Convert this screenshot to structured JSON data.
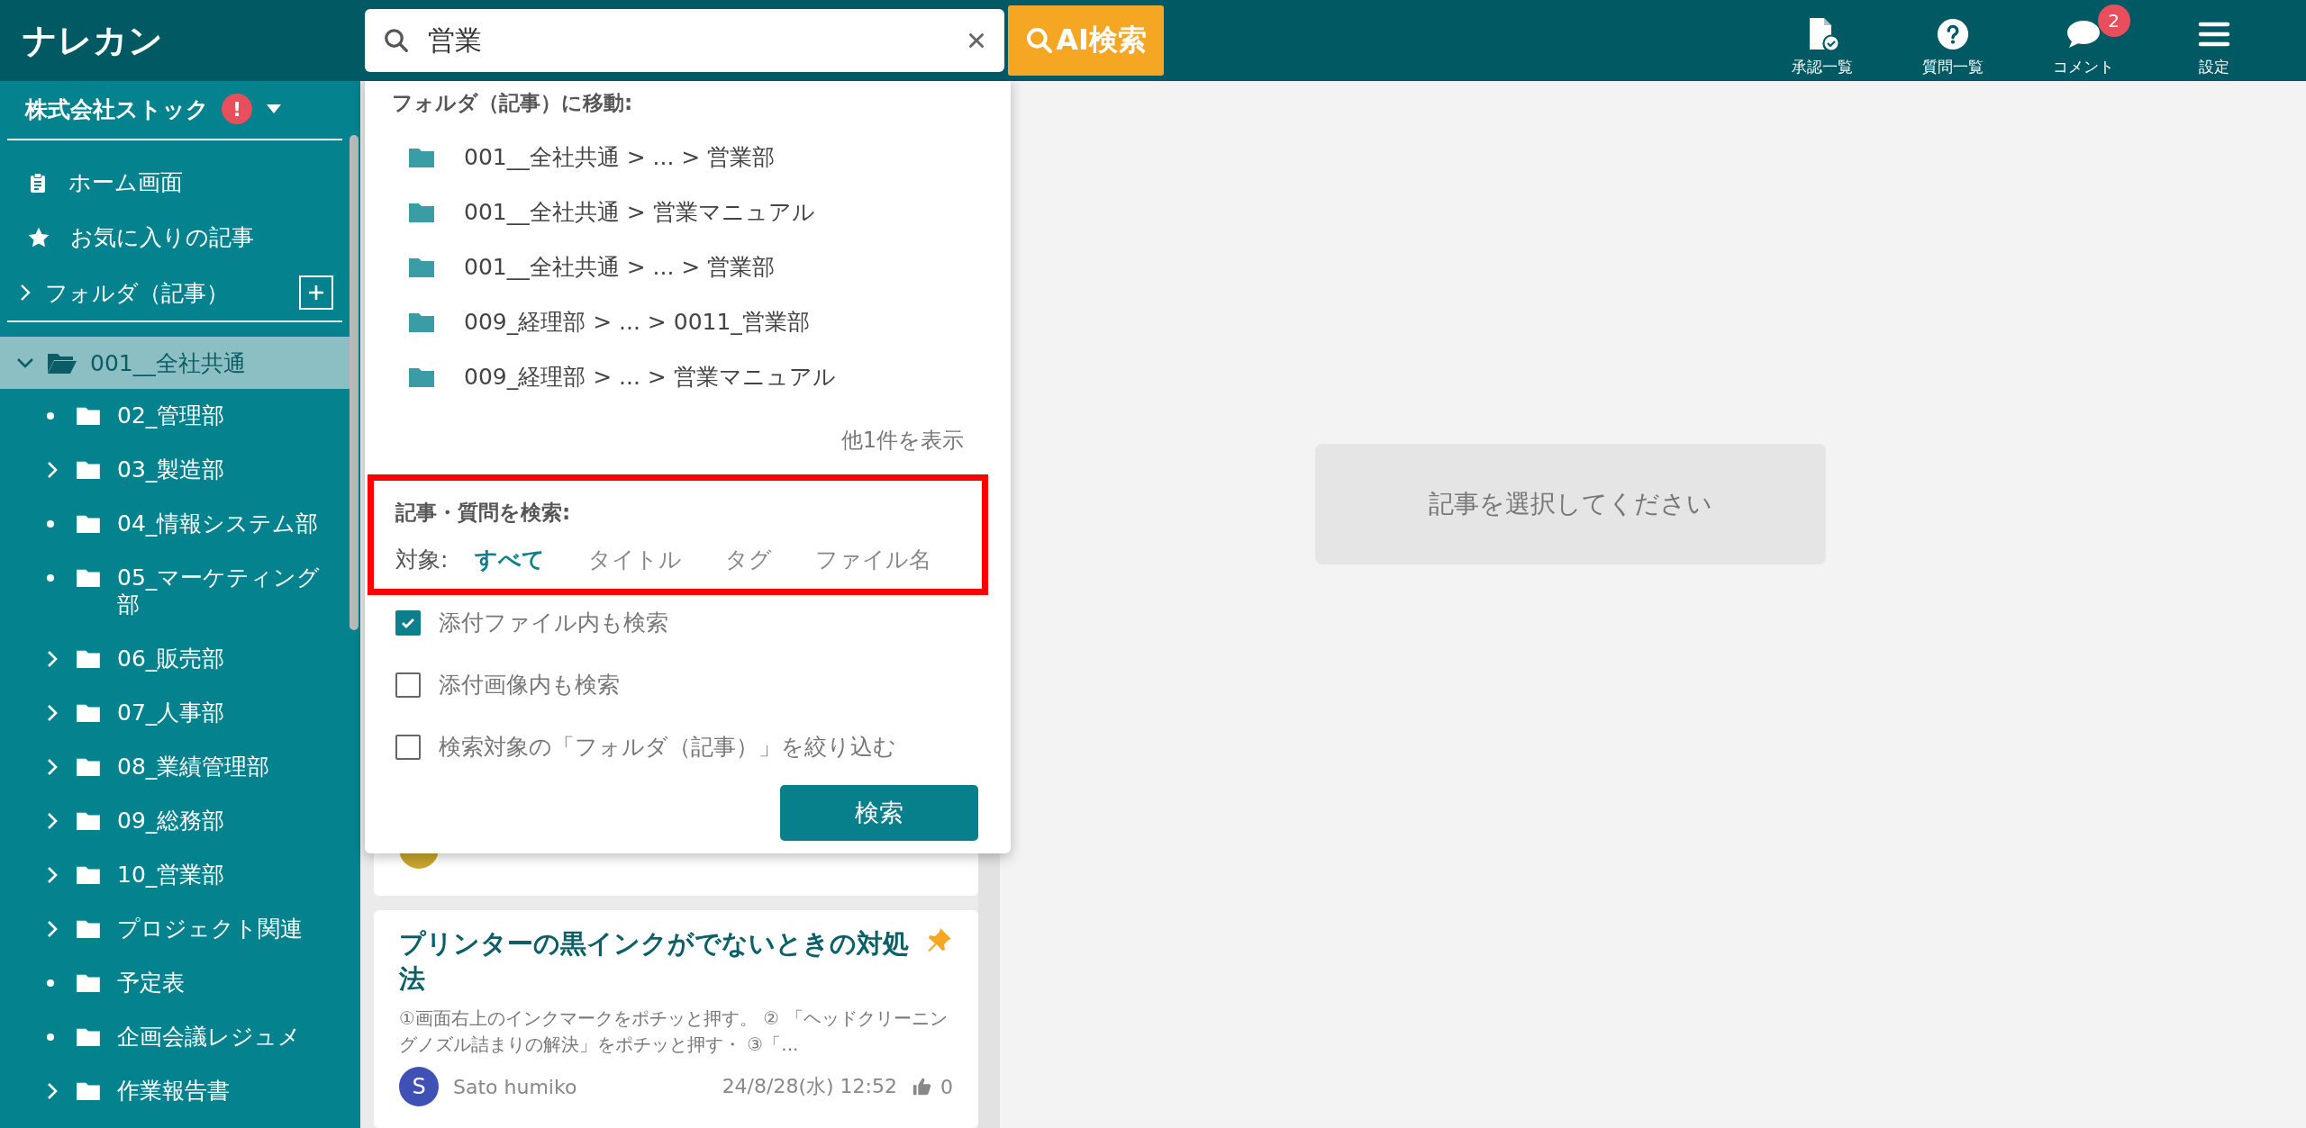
{
  "app": {
    "logo": "ナレカン"
  },
  "search": {
    "value": "営業",
    "ai_button": "AI検索"
  },
  "header_actions": [
    {
      "kind": "approval",
      "label": "承認一覧"
    },
    {
      "kind": "question",
      "label": "質問一覧"
    },
    {
      "kind": "comment",
      "label": "コメント",
      "badge": "2"
    },
    {
      "kind": "menu",
      "label": "設定"
    }
  ],
  "sidebar": {
    "company": "株式会社ストック",
    "alert": "!",
    "nav": [
      {
        "kind": "home",
        "label": "ホーム画面"
      },
      {
        "kind": "favorite",
        "label": "お気に入りの記事"
      }
    ],
    "folders": {
      "label": "フォルダ（記事）",
      "expanded": false
    },
    "tree": [
      {
        "label": "001__全社共通",
        "expanded": true,
        "selected": true,
        "children": [
          {
            "label": "02_管理部",
            "expandable": false,
            "selected": false
          },
          {
            "label": "03_製造部",
            "expandable": true,
            "selected": false
          },
          {
            "label": "04_情報システム部",
            "expandable": false,
            "selected": false
          },
          {
            "label": "05_マーケティング部",
            "expandable": false,
            "selected": false
          },
          {
            "label": "06_販売部",
            "expandable": true,
            "selected": false
          },
          {
            "label": "07_人事部",
            "expandable": true,
            "selected": false
          },
          {
            "label": "08_業績管理部",
            "expandable": true,
            "selected": false
          },
          {
            "label": "09_総務部",
            "expandable": true,
            "selected": false
          },
          {
            "label": "10_営業部",
            "expandable": true,
            "selected": false
          },
          {
            "label": "プロジェクト関連",
            "expandable": true,
            "selected": false
          },
          {
            "label": "予定表",
            "expandable": false,
            "selected": false
          },
          {
            "label": "企画会議レジュメ",
            "expandable": false,
            "selected": false
          },
          {
            "label": "作業報告書",
            "expandable": true,
            "selected": false
          }
        ]
      }
    ]
  },
  "articles": [
    {
      "color": "#c9a52c",
      "pinned": false
    },
    {
      "title": "プリンターの黒インクがでないときの対処法",
      "excerpt": "①画面右上のインクマークをポチッと押す。 ② 「ヘッドクリーニングノズル詰まりの解決」をポチッと押す・ ③「...",
      "avatar_letter": "S",
      "color": "#3f51b5",
      "author": "Sato humiko",
      "date": "24/8/28(水) 12:52",
      "likes": "0",
      "pinned": true
    }
  ],
  "dropdown": {
    "folder_heading": "フォルダ（記事）に移動:",
    "folder_results": [
      "001__全社共通 > ... > 営業部",
      "001__全社共通 > 営業マニュアル",
      "001__全社共通 > ... > 営業部",
      "009_経理部 > ... > 0011_営業部",
      "009_経理部 > ... > 営業マニュアル"
    ],
    "more_link": "他1件を表示",
    "highlighted": true,
    "search_heading": "記事・質問を検索:",
    "target_label": "対象:",
    "targets": [
      {
        "label": "すべて",
        "selected": true
      },
      {
        "label": "タイトル",
        "selected": false
      },
      {
        "label": "タグ",
        "selected": false
      },
      {
        "label": "ファイル名",
        "selected": false
      }
    ],
    "options": [
      {
        "label": "添付ファイル内も検索",
        "checked": true
      },
      {
        "label": "添付画像内も検索",
        "checked": false
      },
      {
        "label": "検索対象の「フォルダ（記事）」を絞り込む",
        "checked": false
      }
    ],
    "submit": "検索"
  },
  "detail": {
    "message": "記事を選択してください"
  }
}
